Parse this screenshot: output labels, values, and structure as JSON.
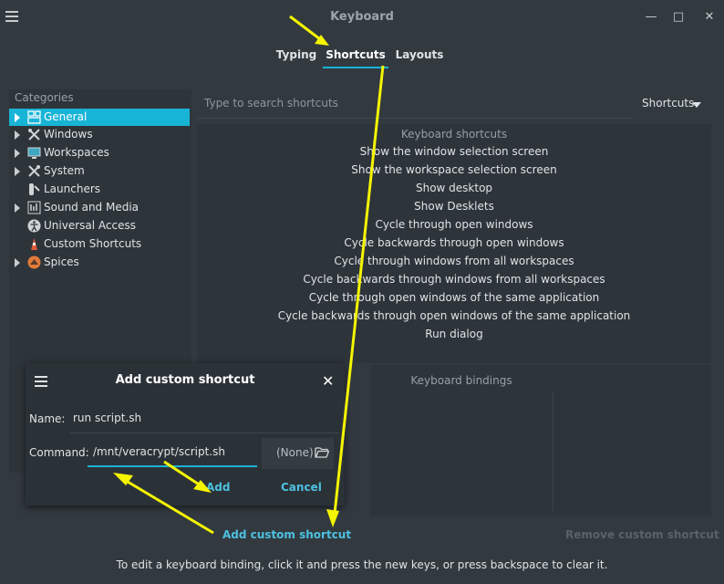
{
  "window": {
    "title": "Keyboard"
  },
  "tabs": [
    {
      "label": "Typing"
    },
    {
      "label": "Shortcuts"
    },
    {
      "label": "Layouts"
    }
  ],
  "sidebar": {
    "label": "Categories",
    "items": [
      {
        "label": "General",
        "icon": "general-icon",
        "selected": true
      },
      {
        "label": "Windows",
        "icon": "windows-icon"
      },
      {
        "label": "Workspaces",
        "icon": "workspaces-icon"
      },
      {
        "label": "System",
        "icon": "system-icon"
      },
      {
        "label": "Launchers",
        "icon": "launchers-icon"
      },
      {
        "label": "Sound and Media",
        "icon": "sound-media-icon"
      },
      {
        "label": "Universal Access",
        "icon": "universal-access-icon"
      },
      {
        "label": "Custom Shortcuts",
        "icon": "custom-shortcuts-icon"
      },
      {
        "label": "Spices",
        "icon": "spices-icon"
      }
    ]
  },
  "search": {
    "placeholder": "Type to search shortcuts"
  },
  "filter_dropdown": {
    "value": "Shortcuts"
  },
  "shortcuts": {
    "header": "Keyboard shortcuts",
    "items": [
      "Show the window selection screen",
      "Show the workspace selection screen",
      "Show desktop",
      "Show Desklets",
      "Cycle through open windows",
      "Cycle backwards through open windows",
      "Cycle through windows from all workspaces",
      "Cycle backwards through windows from all workspaces",
      "Cycle through open windows of the same application",
      "Cycle backwards through open windows of the same application",
      "Run dialog"
    ]
  },
  "bindings": {
    "header": "Keyboard bindings"
  },
  "actions": {
    "add_custom": "Add custom shortcut",
    "remove_custom": "Remove custom shortcut"
  },
  "footer": "To edit a keyboard binding, click it and press the new keys, or press backspace to clear it.",
  "dialog": {
    "title": "Add custom shortcut",
    "name_label": "Name:",
    "name_value": "run script.sh",
    "command_label": "Command:",
    "command_value": "/mnt/veracrypt/script.sh",
    "file_value": "(None)",
    "add_label": "Add",
    "cancel_label": "Cancel"
  },
  "colors": {
    "accent": "#18b4d6",
    "link": "#4ec0e0",
    "annotation": "#f5f500"
  }
}
